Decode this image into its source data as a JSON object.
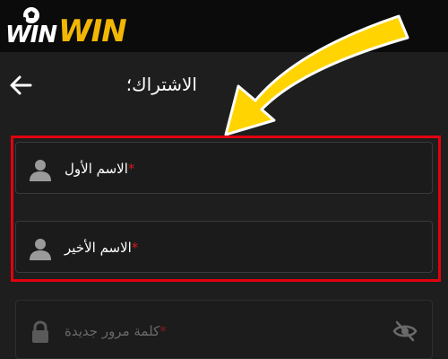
{
  "brand": {
    "logo_part1": "WIN",
    "logo_part2": "WIN",
    "accent_color": "#f2b705"
  },
  "header": {
    "title": "الاشتراك؛",
    "back_icon": "arrow-left-icon"
  },
  "form": {
    "first_name": {
      "label": "الاسم الأول",
      "required": "*",
      "icon": "user-icon"
    },
    "last_name": {
      "label": "الاسم الأخير",
      "required": "*",
      "icon": "user-icon"
    },
    "password": {
      "label": "كلمة مرور جديدة",
      "required": "*",
      "icon": "lock-icon",
      "toggle_icon": "eye-off-icon"
    }
  },
  "annotations": {
    "arrow_color": "#ffd400",
    "highlight_color": "#e3000f"
  }
}
